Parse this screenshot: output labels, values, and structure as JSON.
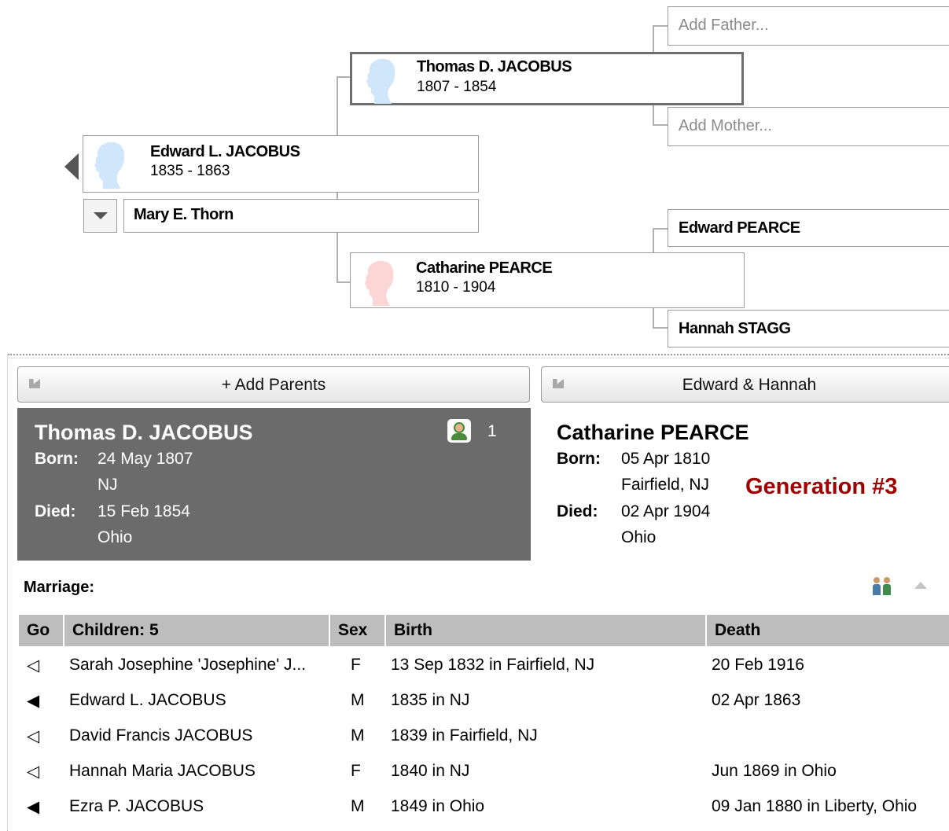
{
  "tree": {
    "gp_father_paternal": "Add Father...",
    "gp_mother_paternal": "Add Mother...",
    "father": {
      "name": "Thomas D. JACOBUS",
      "dates": "1807 - 1854"
    },
    "root": {
      "name": "Edward L. JACOBUS",
      "dates": "1835 - 1863"
    },
    "spouse": {
      "name": "Mary E. Thorn"
    },
    "mother": {
      "name": "Catharine PEARCE",
      "dates": "1810 - 1904"
    },
    "gp_father_maternal": "Edward PEARCE",
    "gp_mother_maternal": "Hannah STAGG"
  },
  "buttons": {
    "add_parents": "+ Add Parents",
    "parents_right": "Edward & Hannah"
  },
  "left_panel": {
    "name": "Thomas D. JACOBUS",
    "media_count": "1",
    "born_label": "Born:",
    "born_date": "24 May 1807",
    "born_place": "NJ",
    "died_label": "Died:",
    "died_date": "15 Feb 1854",
    "died_place": "Ohio"
  },
  "right_panel": {
    "name": "Catharine PEARCE",
    "born_label": "Born:",
    "born_date": "05 Apr 1810",
    "born_place": "Fairfield, NJ",
    "died_label": "Died:",
    "died_date": "02 Apr 1904",
    "died_place": "Ohio",
    "annotation": "Generation #3"
  },
  "marriage": {
    "label": "Marriage:"
  },
  "children_table": {
    "headers": [
      "Go",
      "Children: 5",
      "Sex",
      "Birth",
      "Death"
    ],
    "rows": [
      {
        "go": "◁",
        "name": "Sarah Josephine 'Josephine' J...",
        "sex": "F",
        "birth": "13 Sep 1832 in Fairfield, NJ",
        "death": "20 Feb 1916"
      },
      {
        "go": "◀",
        "name": "Edward L. JACOBUS",
        "sex": "M",
        "birth": "1835 in NJ",
        "death": "02 Apr 1863"
      },
      {
        "go": "◁",
        "name": "David Francis JACOBUS",
        "sex": "M",
        "birth": "1839 in Fairfield, NJ",
        "death": ""
      },
      {
        "go": "◁",
        "name": "Hannah Maria JACOBUS",
        "sex": "F",
        "birth": "1840 in NJ",
        "death": "Jun 1869 in Ohio"
      },
      {
        "go": "◀",
        "name": "Ezra P. JACOBUS",
        "sex": "M",
        "birth": "1849 in Ohio",
        "death": "09 Jan 1880 in Liberty, Ohio"
      }
    ]
  },
  "colors": {
    "selected_panel_bg": "#6b6b6b",
    "annotation": "#a00000",
    "male_silhouette": "#cfe6fb",
    "female_silhouette": "#fcd6d4",
    "header_bg": "#bdbdbd"
  }
}
